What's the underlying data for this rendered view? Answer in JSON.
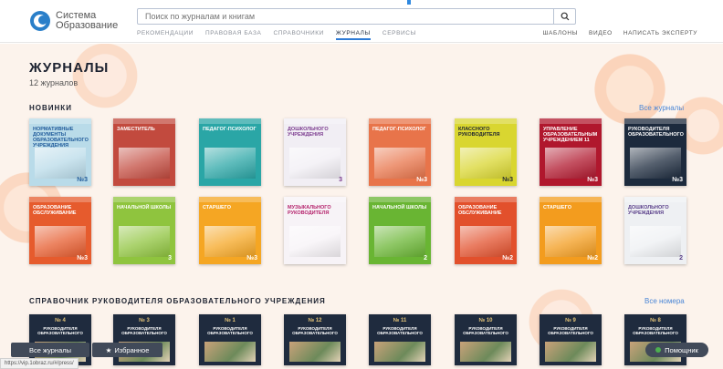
{
  "header": {
    "logo_line1": "Система",
    "logo_line2": "Образование",
    "search_placeholder": "Поиск по журналам и книгам",
    "nav": [
      "РЕКОМЕНДАЦИИ",
      "ПРАВОВАЯ БАЗА",
      "СПРАВОЧНИКИ",
      "ЖУРНАЛЫ",
      "СЕРВИСЫ"
    ],
    "nav_active": "ЖУРНАЛЫ",
    "nav_right": [
      "ШАБЛОНЫ",
      "ВИДЕО",
      "НАПИСАТЬ ЭКСПЕРТУ"
    ]
  },
  "page": {
    "title": "ЖУРНАЛЫ",
    "count": "12 журналов"
  },
  "novelties": {
    "title": "НОВИНКИ",
    "more": "Все журналы",
    "row1": [
      {
        "title": "НОРМАТИВНЫЕ ДОКУМЕНТЫ ОБРАЗОВАТЕЛЬНОГО УЧРЕЖДЕНИЯ",
        "num": "№3",
        "bg": "#b9dbe9",
        "fg": "#1f5a9a"
      },
      {
        "title": "ЗАМЕСТИТЕЛЬ",
        "num": "",
        "bg": "#c24a3e",
        "fg": "#ffffff"
      },
      {
        "title": "ПЕДАГОГ-ПСИХОЛОГ",
        "num": "",
        "bg": "#2aa6a6",
        "fg": "#ffffff"
      },
      {
        "title": "ДОШКОЛЬНОГО УЧРЕЖДЕНИЯ",
        "num": "3",
        "bg": "#f1eef4",
        "fg": "#7a3a8e"
      },
      {
        "title": "ПЕДАГОГ-ПСИХОЛОГ",
        "num": "№3",
        "bg": "#e8744a",
        "fg": "#ffffff"
      },
      {
        "title": "КЛАССНОГО РУКОВОДИТЕЛЯ",
        "num": "№3",
        "bg": "#d9d630",
        "fg": "#1c2230"
      },
      {
        "title": "УПРАВЛЕНИЕ ОБРАЗОВАТЕЛЬНЫМ УЧРЕЖДЕНИЕМ 11",
        "num": "№3",
        "bg": "#b0172d",
        "fg": "#ffffff"
      },
      {
        "title": "РУКОВОДИТЕЛЯ ОБРАЗОВАТЕЛЬНОГО",
        "num": "№3",
        "bg": "#1c2a3d",
        "fg": "#ffffff"
      }
    ],
    "row2": [
      {
        "title": "ОБРАЗОВАНИЕ ОБСЛУЖИВАНИЕ",
        "num": "№3",
        "bg": "#e65b2d",
        "fg": "#ffffff"
      },
      {
        "title": "НАЧАЛЬНОЙ ШКОЛЫ",
        "num": "3",
        "bg": "#8fc43e",
        "fg": "#ffffff"
      },
      {
        "title": "СТАРШЕГО",
        "num": "№3",
        "bg": "#f5a623",
        "fg": "#ffffff"
      },
      {
        "title": "МУЗЫКАЛЬНОГО РУКОВОДИТЕЛЯ",
        "num": "",
        "bg": "#f7f3f7",
        "fg": "#b5246d"
      },
      {
        "title": "НАЧАЛЬНОЙ ШКОЛЫ",
        "num": "2",
        "bg": "#69b533",
        "fg": "#ffffff"
      },
      {
        "title": "ОБРАЗОВАНИЕ ОБСЛУЖИВАНИЕ",
        "num": "№2",
        "bg": "#e2502c",
        "fg": "#ffffff"
      },
      {
        "title": "СТАРШЕГО",
        "num": "№2",
        "bg": "#f39c1e",
        "fg": "#ffffff"
      },
      {
        "title": "ДОШКОЛЬНОГО УЧРЕЖДЕНИЯ",
        "num": "2",
        "bg": "#eef0f3",
        "fg": "#5a3f8a"
      }
    ]
  },
  "handbook": {
    "title": "СПРАВОЧНИК РУКОВОДИТЕЛЯ ОБРАЗОВАТЕЛЬНОГО УЧРЕЖДЕНИЯ",
    "more": "Все номера",
    "covers": [
      {
        "num": "№ 4",
        "title": "РУКОВОДИТЕЛЯ ОБРАЗОВАТЕЛЬНОГО"
      },
      {
        "num": "№ 3",
        "title": "РУКОВОДИТЕЛЯ ОБРАЗОВАТЕЛЬНОГО"
      },
      {
        "num": "№ 1",
        "title": "РУКОВОДИТЕЛЯ ОБРАЗОВАТЕЛЬНОГО"
      },
      {
        "num": "№ 12",
        "title": "РУКОВОДИТЕЛЯ ОБРАЗОВАТЕЛЬНОГО"
      },
      {
        "num": "№ 11",
        "title": "РУКОВОДИТЕЛЯ ОБРАЗОВАТЕЛЬНОГО"
      },
      {
        "num": "№ 10",
        "title": "РУКОВОДИТЕЛЯ ОБРАЗОВАТЕЛЬНОГО"
      },
      {
        "num": "№ 9",
        "title": "РУКОВОДИТЕЛЯ ОБРАЗОВАТЕЛЬНОГО"
      },
      {
        "num": "№ 8",
        "title": "РУКОВОДИТЕЛЯ ОБРАЗОВАТЕЛЬНОГО"
      }
    ]
  },
  "bottom": {
    "all_journals": "Все журналы",
    "favorites": "Избранное",
    "helper": "Помощник",
    "status_url": "https://vip.1obraz.ru/#/press/"
  },
  "colors": {
    "accent": "#2e7bd6",
    "dark_button": "#414a59",
    "link": "#4a86d6"
  }
}
